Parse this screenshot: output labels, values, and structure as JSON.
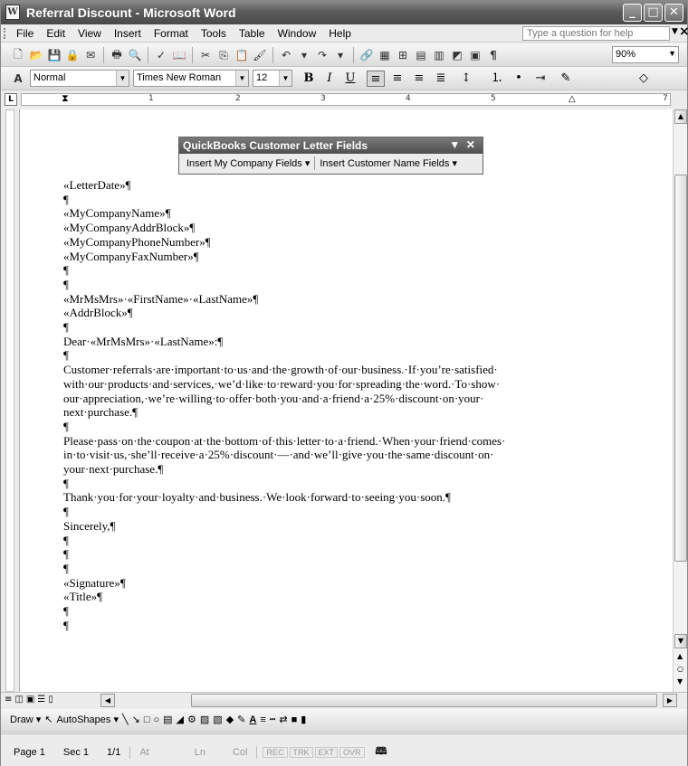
{
  "window": {
    "title": "Referral Discount - Microsoft Word",
    "app_icon": "W",
    "controls": [
      "minimize",
      "maximize",
      "close"
    ]
  },
  "menubar": {
    "items": [
      "File",
      "Edit",
      "View",
      "Insert",
      "Format",
      "Tools",
      "Table",
      "Window",
      "Help"
    ],
    "help_placeholder": "Type a question for help",
    "close_doc": "×"
  },
  "standard_toolbar": {
    "zoom": "90%"
  },
  "formatting_toolbar": {
    "style": "Normal",
    "font": "Times New Roman",
    "size": "12",
    "bold": "B",
    "italic": "I",
    "underline": "U"
  },
  "ruler": {
    "numbers": [
      "1",
      "2",
      "3",
      "4",
      "5",
      "7"
    ]
  },
  "quickbooks_toolbar": {
    "title": "QuickBooks Customer Letter Fields",
    "buttons": [
      "Insert My Company Fields ▾",
      "Insert Customer Name Fields ▾"
    ]
  },
  "document": {
    "paragraphs": [
      "«LetterDate»¶",
      "¶",
      "«MyCompanyName»¶",
      "«MyCompanyAddrBlock»¶",
      "«MyCompanyPhoneNumber»¶",
      "«MyCompanyFaxNumber»¶",
      "¶",
      "¶",
      "«MrMsMrs»·«FirstName»·«LastName»¶",
      "«AddrBlock»¶",
      "¶",
      "Dear·«MrMsMrs»·«LastName»:¶",
      "¶",
      "Customer·referrals·are·important·to·us·and·the·growth·of·our·business.·If·you’re·satisfied·\nwith·our·products·and·services,·we’d·like·to·reward·you·for·spreading·the·word.·To·show·\nour·appreciation,·we’re·willing·to·offer·both·you·and·a·friend·a·25%·discount·on·your·\nnext·purchase.¶",
      "¶",
      "Please·pass·on·the·coupon·at·the·bottom·of·this·letter·to·a·friend.·When·your·friend·comes·\nin·to·visit·us,·she’ll·receive·a·25%·discount·—·and·we’ll·give·you·the·same·discount·on·\nyour·next·purchase.¶",
      "¶",
      "Thank·you·for·your·loyalty·and·business.·We·look·forward·to·seeing·you·soon.¶",
      "¶",
      "Sincerely,¶",
      "¶",
      "¶",
      "¶",
      "«Signature»¶",
      "«Title»¶",
      "¶",
      "¶"
    ]
  },
  "drawing_toolbar": {
    "draw": "Draw ▾",
    "autoshapes": "AutoShapes ▾"
  },
  "statusbar": {
    "page": "Page 1",
    "sec": "Sec 1",
    "pages": "1/1",
    "at": "At",
    "ln": "Ln",
    "col": "Col",
    "rec": "REC",
    "trk": "TRK",
    "ext": "EXT",
    "ovr": "OVR"
  }
}
